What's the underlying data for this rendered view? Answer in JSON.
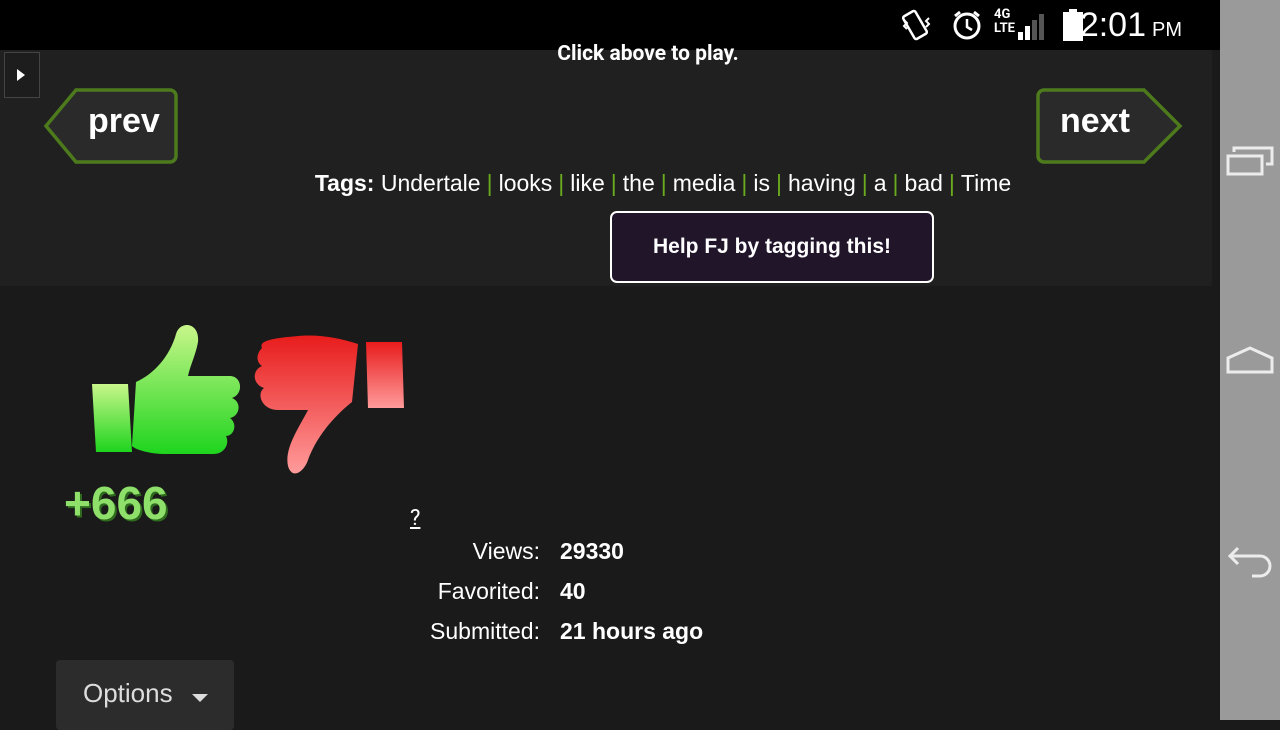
{
  "status_bar": {
    "time": "12:01",
    "ampm": "PM",
    "network": "4G LTE",
    "icons": [
      "vibrate-icon",
      "alarm-icon",
      "signal-icon",
      "battery-icon"
    ]
  },
  "page": {
    "play_hint": "Click above to play.",
    "prev_label": "prev",
    "next_label": "next",
    "tags_label": "Tags:",
    "tags": [
      "Undertale",
      "looks",
      "like",
      "the",
      "media",
      "is",
      "having",
      "a",
      "bad",
      "Time"
    ],
    "help_button": "Help FJ by tagging this!",
    "rating": "+666",
    "help_link": "?",
    "stats": [
      {
        "label": "Views:",
        "value": "29330"
      },
      {
        "label": "Favorited:",
        "value": "40"
      },
      {
        "label": "Submitted:",
        "value": "21 hours ago"
      }
    ],
    "options_label": "Options"
  },
  "colors": {
    "background": "#1a1a1a",
    "panel": "#202020",
    "accent_green": "#6aaa1e",
    "thumb_up": "#3fd62a",
    "thumb_down": "#e8242a",
    "help_bg": "#21152a"
  }
}
